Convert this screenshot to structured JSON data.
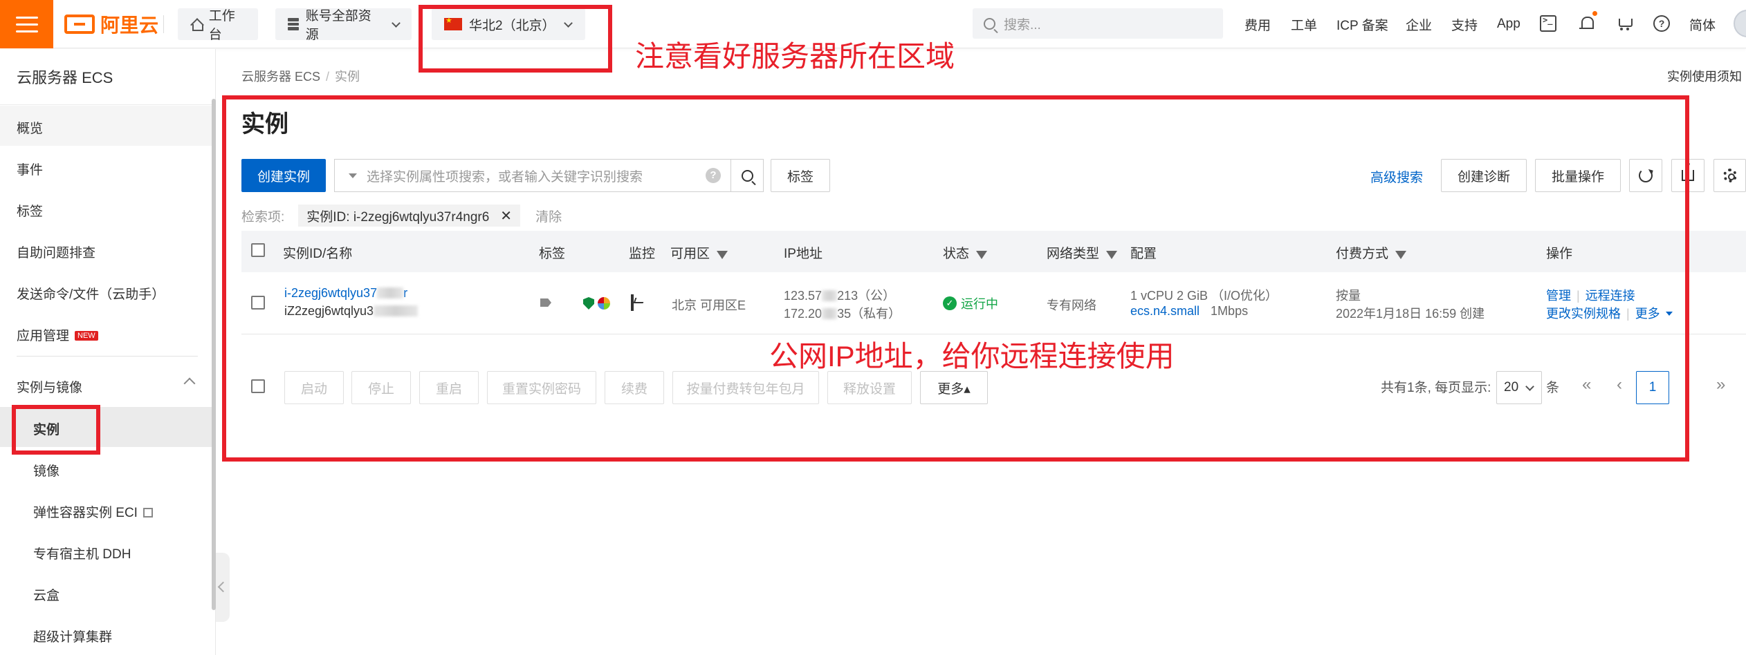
{
  "topbar": {
    "logo": "阿里云",
    "workbench": "工作台",
    "resources": "账号全部资源",
    "region": "华北2（北京）",
    "search_placeholder": "搜索...",
    "nav": [
      "费用",
      "工单",
      "ICP 备案",
      "企业",
      "支持",
      "App"
    ],
    "language": "简体",
    "icons": [
      "terminal-icon",
      "bell-icon",
      "cart-icon",
      "help-icon"
    ]
  },
  "sidebar": {
    "title": "云服务器 ECS",
    "items": [
      "概览",
      "事件",
      "标签",
      "自助问题排查",
      "发送命令/文件（云助手）",
      "应用管理"
    ],
    "new_badge": "NEW",
    "group": "实例与镜像",
    "sub_items": [
      "实例",
      "镜像",
      "弹性容器实例 ECI",
      "专有宿主机 DDH",
      "云盒",
      "超级计算集群"
    ]
  },
  "breadcrumb": [
    "云服务器 ECS",
    "实例"
  ],
  "notice_link": "实例使用须知",
  "page_title": "实例",
  "toolbar": {
    "create": "创建实例",
    "filter_placeholder": "选择实例属性项搜索，或者输入关键字识别搜索",
    "tag": "标签",
    "advanced_search": "高级搜索",
    "diagnose": "创建诊断",
    "batch": "批量操作"
  },
  "search_tags": {
    "label": "检索项:",
    "chip": "实例ID: i-2zegj6wtqlyu37r4ngr6",
    "clear": "清除"
  },
  "table": {
    "headers": [
      "实例ID/名称",
      "标签",
      "监控",
      "可用区",
      "IP地址",
      "状态",
      "网络类型",
      "配置",
      "付费方式",
      "操作"
    ],
    "row": {
      "id": "i-2zegj6wtqlyu37",
      "id_tail": "r",
      "name": "iZ2zegj6wtqlyu3",
      "zone": "北京 可用区E",
      "ip_public_prefix": "123.57",
      "ip_public_suffix": "213（公）",
      "ip_private_prefix": "172.20",
      "ip_private_suffix": "35（私有）",
      "status": "运行中",
      "network": "专有网络",
      "config": "1 vCPU 2 GiB （I/O优化）",
      "spec": "ecs.n4.small",
      "bandwidth": "1Mbps",
      "billing": "按量",
      "created": "2022年1月18日 16:59 创建",
      "actions": [
        "管理",
        "远程连接",
        "更改实例规格",
        "更多"
      ]
    }
  },
  "footer": {
    "buttons": [
      "启动",
      "停止",
      "重启",
      "重置实例密码",
      "续费",
      "按量付费转包年包月",
      "释放设置"
    ],
    "more": "更多▴",
    "total": "共有1条, 每页显示:",
    "page_size": "20",
    "unit": "条",
    "current_page": "1"
  },
  "annotations": {
    "region_note": "注意看好服务器所在区域",
    "ip_note": "公网IP地址，给你远程连接使用"
  },
  "colors": {
    "accent": "#ff6a00",
    "primary": "#0064c8",
    "annotation": "#e8202a",
    "running": "#13a547"
  }
}
